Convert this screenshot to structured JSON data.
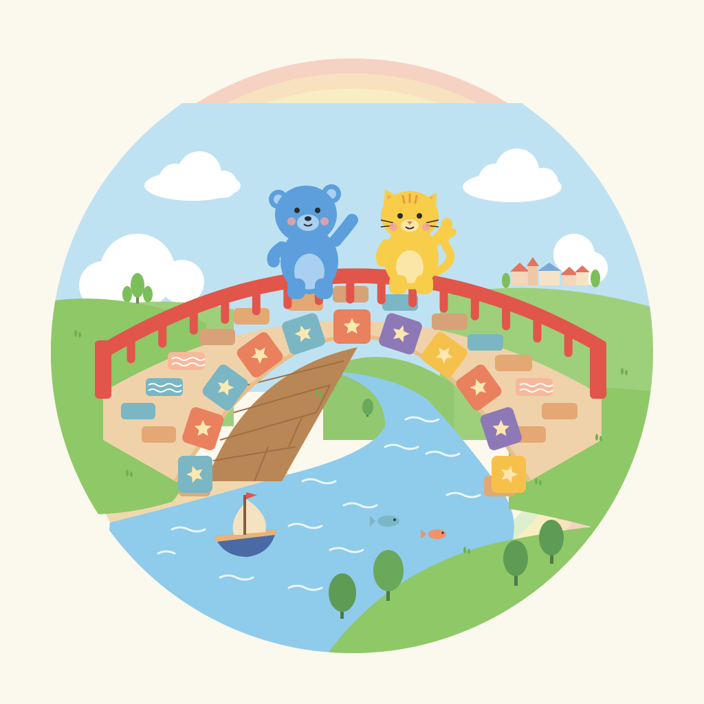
{
  "scene": {
    "subjects": [
      "blue-bear",
      "yellow-cat"
    ],
    "elements": [
      "rainbow",
      "clouds",
      "hills",
      "river",
      "arched-bridge",
      "sailboat",
      "fish",
      "trees",
      "village"
    ]
  },
  "colors": {
    "background": "#fbf8ee",
    "sky": "#bfe2f2",
    "grass": "#8ec867",
    "grass_dark": "#6fb04f",
    "river": "#8fcbea",
    "bridge_stone": "#f0d2aa",
    "railing": "#e2554a",
    "bear": "#5c9fdc",
    "cat": "#f7cd4a",
    "rainbow": [
      "#f6c9b9",
      "#f8dcb3",
      "#f7eeb8",
      "#d6ecc4",
      "#c8e4ec"
    ]
  },
  "bridge": {
    "arch_tiles": [
      {
        "color": "#7ab6c4",
        "icon": "star-icon"
      },
      {
        "color": "#e9805e",
        "icon": "star-icon"
      },
      {
        "color": "#7ab6c4",
        "icon": "star-icon"
      },
      {
        "color": "#e9805e",
        "icon": "star-icon"
      },
      {
        "color": "#7ab6c4",
        "icon": "star-icon"
      },
      {
        "color": "#e9805e",
        "icon": "star-icon"
      },
      {
        "color": "#8d79b6",
        "icon": "star-icon"
      },
      {
        "color": "#f6c14a",
        "icon": "star-icon"
      },
      {
        "color": "#e9805e",
        "icon": "star-icon"
      },
      {
        "color": "#8d79b6",
        "icon": "star-icon"
      },
      {
        "color": "#f6c14a",
        "icon": "star-icon"
      }
    ]
  }
}
